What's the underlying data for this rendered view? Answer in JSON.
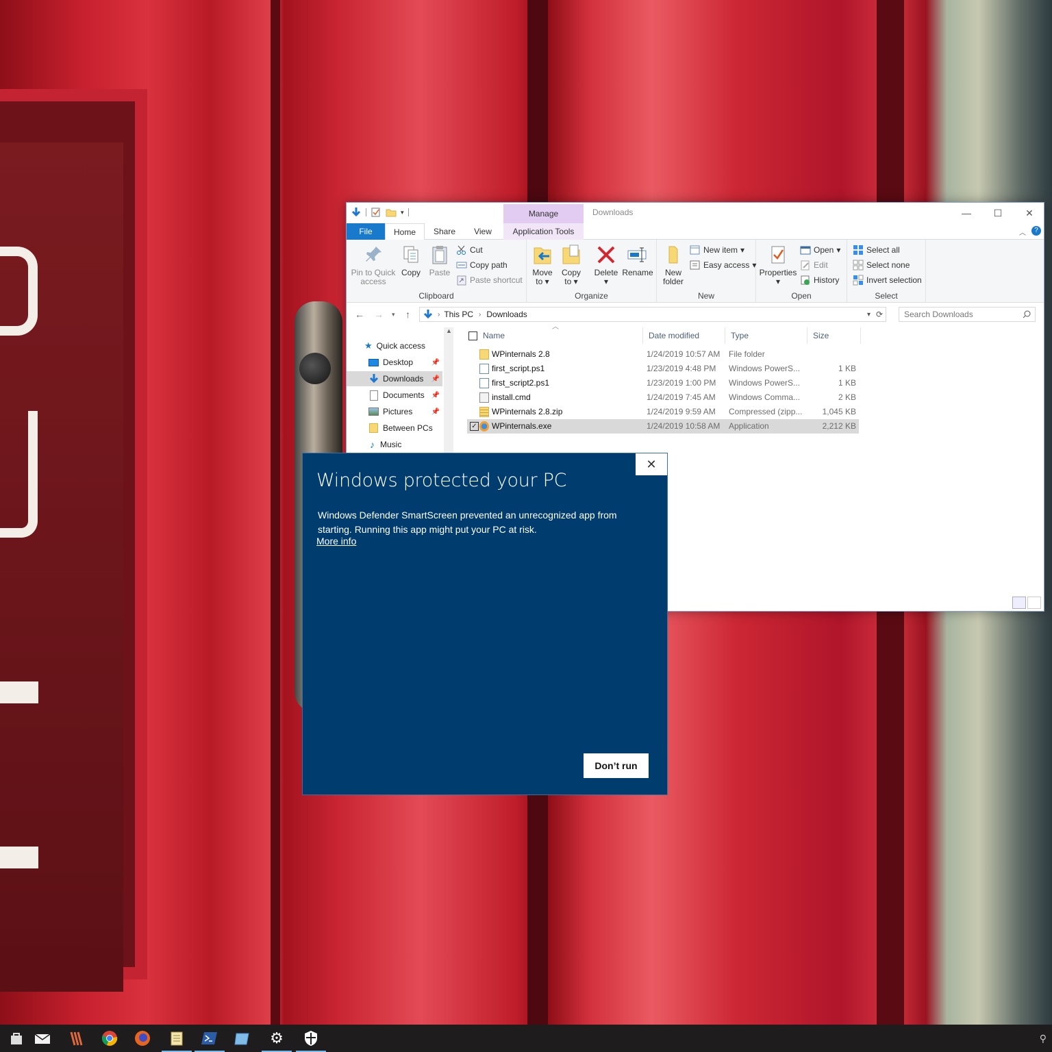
{
  "explorer": {
    "title": "Downloads",
    "contextual_tab_group": "Manage",
    "tabs": {
      "file": "File",
      "home": "Home",
      "share": "Share",
      "view": "View",
      "app_tools": "Application Tools"
    },
    "ribbon": {
      "clipboard": {
        "label": "Clipboard",
        "pin": "Pin to Quick access",
        "pin_line1": "Pin to Quick",
        "pin_line2": "access",
        "copy": "Copy",
        "paste": "Paste",
        "cut": "Cut",
        "copy_path": "Copy path",
        "paste_shortcut": "Paste shortcut"
      },
      "organize": {
        "label": "Organize",
        "move_to_line1": "Move",
        "move_to_line2": "to",
        "copy_to_line1": "Copy",
        "copy_to_line2": "to",
        "delete": "Delete",
        "rename": "Rename"
      },
      "new": {
        "label": "New",
        "new_folder_line1": "New",
        "new_folder_line2": "folder",
        "new_item": "New item",
        "easy_access": "Easy access"
      },
      "open": {
        "label": "Open",
        "properties": "Properties",
        "open": "Open",
        "edit": "Edit",
        "history": "History"
      },
      "select": {
        "label": "Select",
        "select_all": "Select all",
        "select_none": "Select none",
        "invert_selection": "Invert selection"
      }
    },
    "address": {
      "crumbs": [
        "This PC",
        "Downloads"
      ],
      "search_placeholder": "Search Downloads"
    },
    "nav": {
      "items": [
        {
          "label": "Quick access",
          "pinned": false
        },
        {
          "label": "Desktop",
          "pinned": true
        },
        {
          "label": "Downloads",
          "pinned": true
        },
        {
          "label": "Documents",
          "pinned": true
        },
        {
          "label": "Pictures",
          "pinned": true
        },
        {
          "label": "Between PCs",
          "pinned": false
        },
        {
          "label": "Music",
          "pinned": false
        }
      ]
    },
    "columns": {
      "name": "Name",
      "date": "Date modified",
      "type": "Type",
      "size": "Size"
    },
    "files": [
      {
        "name": "WPinternals 2.8",
        "date": "1/24/2019 10:57 AM",
        "type": "File folder",
        "size": ""
      },
      {
        "name": "first_script.ps1",
        "date": "1/23/2019 4:48 PM",
        "type": "Windows PowerS...",
        "size": "1 KB"
      },
      {
        "name": "first_script2.ps1",
        "date": "1/23/2019 1:00 PM",
        "type": "Windows PowerS...",
        "size": "1 KB"
      },
      {
        "name": "install.cmd",
        "date": "1/24/2019 7:45 AM",
        "type": "Windows Comma...",
        "size": "2 KB"
      },
      {
        "name": "WPinternals 2.8.zip",
        "date": "1/24/2019 9:59 AM",
        "type": "Compressed (zipp...",
        "size": "1,045 KB"
      },
      {
        "name": "WPinternals.exe",
        "date": "1/24/2019 10:58 AM",
        "type": "Application",
        "size": "2,212 KB"
      }
    ]
  },
  "dialog": {
    "title": "Windows protected your PC",
    "body": "Windows Defender SmartScreen prevented an unrecognized app from starting. Running this app might put your PC at risk.",
    "link": "More info",
    "button": "Don’t run",
    "close": "✕"
  },
  "colors": {
    "file_tab": "#1979ca",
    "dialog_bg": "#003c6e",
    "manage_tab": "#e3ccf2"
  }
}
